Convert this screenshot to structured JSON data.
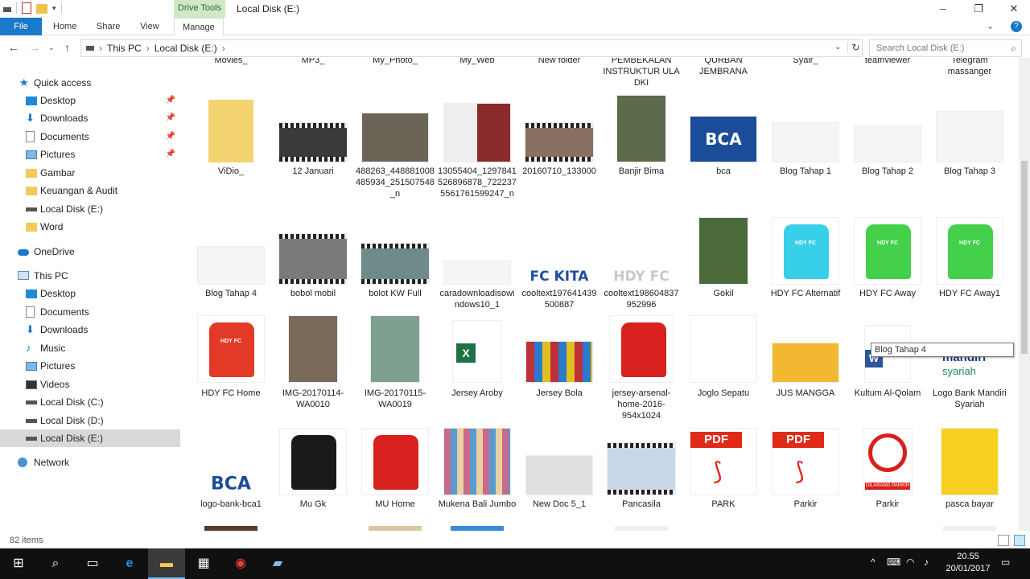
{
  "window": {
    "title": "Local Disk (E:)",
    "drive_tools_label": "Drive Tools",
    "minimize": "–",
    "maximize": "❐",
    "close": "✕",
    "ribbon_collapse": "⌄",
    "help": "?"
  },
  "ribbon": {
    "tabs": [
      {
        "label": "File"
      },
      {
        "label": "Home"
      },
      {
        "label": "Share"
      },
      {
        "label": "View"
      },
      {
        "label": "Manage"
      }
    ]
  },
  "address": {
    "crumbs": [
      "This PC",
      "Local Disk (E:)"
    ],
    "separator": "›",
    "search_placeholder": "Search Local Disk (E:)"
  },
  "nav": {
    "quick_access": "Quick access",
    "items_quick": [
      {
        "label": "Desktop",
        "pinned": true,
        "icon": "desktop-icon"
      },
      {
        "label": "Downloads",
        "pinned": true,
        "icon": "downloads-icon"
      },
      {
        "label": "Documents",
        "pinned": true,
        "icon": "documents-icon"
      },
      {
        "label": "Pictures",
        "pinned": true,
        "icon": "pictures-icon"
      },
      {
        "label": "Gambar",
        "pinned": false,
        "icon": "folder-icon"
      },
      {
        "label": "Keuangan & Audit",
        "pinned": false,
        "icon": "folder-icon"
      },
      {
        "label": "Local Disk (E:)",
        "pinned": false,
        "icon": "drive-icon"
      },
      {
        "label": "Word",
        "pinned": false,
        "icon": "folder-icon"
      }
    ],
    "onedrive": "OneDrive",
    "this_pc": "This PC",
    "items_pc": [
      {
        "label": "Desktop",
        "icon": "desktop-icon"
      },
      {
        "label": "Documents",
        "icon": "documents-icon"
      },
      {
        "label": "Downloads",
        "icon": "downloads-icon"
      },
      {
        "label": "Music",
        "icon": "music-icon"
      },
      {
        "label": "Pictures",
        "icon": "pictures-icon"
      },
      {
        "label": "Videos",
        "icon": "videos-icon"
      },
      {
        "label": "Local Disk (C:)",
        "icon": "drive-icon"
      },
      {
        "label": "Local Disk (D:)",
        "icon": "drive-icon"
      },
      {
        "label": "Local Disk (E:)",
        "icon": "drive-icon",
        "selected": true
      }
    ],
    "network": "Network"
  },
  "files": {
    "row0": [
      "Movies_",
      "MP3_",
      "My_Photo_",
      "My_Web",
      "New folder",
      "PEMBEKALAN INSTRUKTUR ULA DKI",
      "QURBAN JEMBRANA",
      "Syair_",
      "teamviewer",
      "Telegram massanger"
    ],
    "row1": [
      "ViDio_",
      "12 Januari",
      "488263_448881008485934_251507548_n",
      "13055404_1297841526896878_7222375561761599247_n",
      "20160710_133000",
      "Banjir Bima",
      "bca",
      "Blog Tahap 1",
      "Blog Tahap 2",
      "Blog Tahap 3"
    ],
    "row2": [
      "Blog Tahap 4",
      "bobol mobil",
      "bolot KW Full",
      "caradownloadisowindows10_1",
      "cooltext197641439500887",
      "cooltext198604837952996",
      "Gokil",
      "HDY FC Alternatif",
      "HDY FC Away",
      "HDY FC Away1"
    ],
    "row3": [
      "HDY FC Home",
      "IMG-20170114-WA0010",
      "IMG-20170115-WA0019",
      "Jersey Aroby",
      "Jersey Bola",
      "jersey-arsenal-home-2016-954x1024",
      "Joglo Sepatu",
      "JUS MANGGA",
      "Kultum Al-Qolam",
      "Logo Bank Mandiri Syariah"
    ],
    "row4": [
      "logo-bank-bca1",
      "Mu Gk",
      "MU Home",
      "Mukena Bali Jumbo",
      "New Doc 5_1",
      "Pancasila",
      "PARK",
      "Parkir",
      "Parkir",
      "pasca bayar"
    ]
  },
  "thumb_text": {
    "bca": "BCA",
    "fckita": "FC KITA",
    "hdyfc": "HDY FC",
    "pdf": "PDF",
    "dilarang": "DILARANG PARKIR",
    "mandiri": "mandiri",
    "syariah": "syariah"
  },
  "tooltip": "Blog Tahap 4",
  "status": {
    "items_count": "82 items"
  },
  "taskbar": {
    "time": "20.55",
    "date": "20/01/2017"
  }
}
